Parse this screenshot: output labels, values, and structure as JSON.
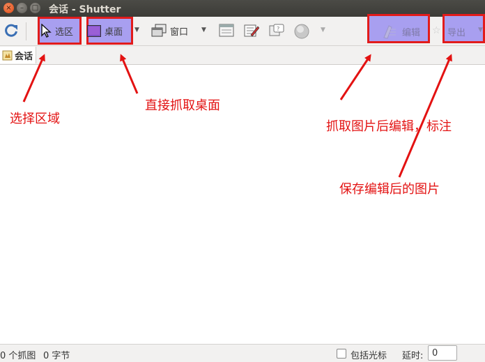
{
  "window": {
    "title": "会话 - Shutter",
    "controls": {
      "close": "×",
      "minimize": "–",
      "maximize": "□"
    }
  },
  "toolbar": {
    "refresh_icon": "refresh-icon",
    "selection_label": "选区",
    "desktop_label": "桌面",
    "window_label": "窗口",
    "edit_label": "编辑",
    "export_label": "导出"
  },
  "session_tab": {
    "label": "会话"
  },
  "statusbar": {
    "count": "0 个抓图",
    "size": "0 字节",
    "include_cursor_label": "包括光标",
    "delay_label": "延时:",
    "delay_value": "0"
  },
  "annotations": {
    "select_area": "选择区域",
    "capture_desktop": "直接抓取桌面",
    "edit_after_capture": "抓取图片后编辑，标注",
    "save_after_edit": "保存编辑后的图片"
  },
  "colors": {
    "highlight_fill": "#a89ff0",
    "highlight_border": "#e21b1b",
    "annotation_text": "#e31212"
  }
}
